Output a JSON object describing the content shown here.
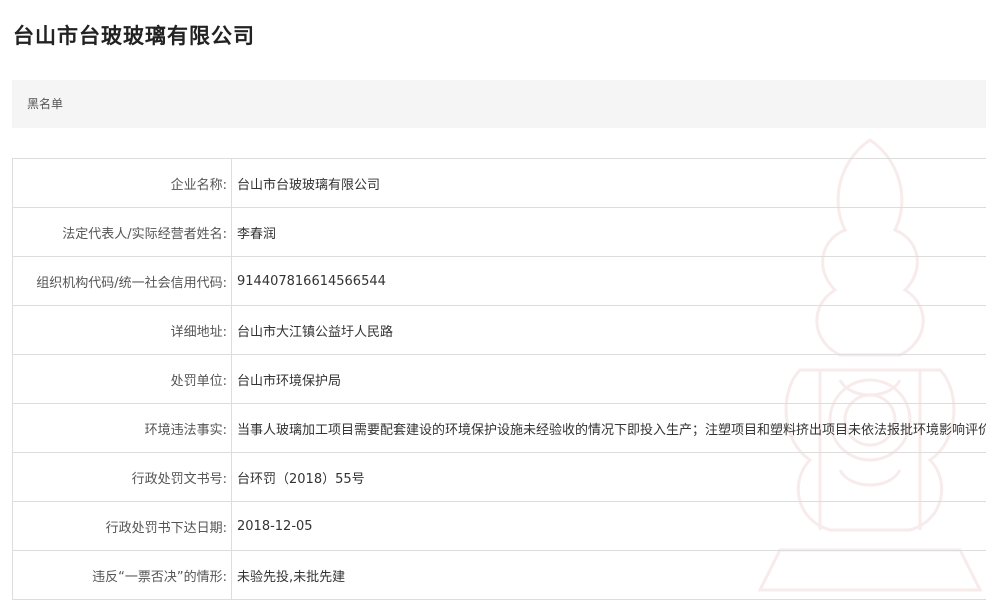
{
  "company_name_title": "台山市台玻玻璃有限公司",
  "category": "黑名单",
  "rows": [
    {
      "label": "企业名称:",
      "value": "台山市台玻玻璃有限公司"
    },
    {
      "label": "法定代表人/实际经营者姓名:",
      "value": "李春润"
    },
    {
      "label": "组织机构代码/统一社会信用代码:",
      "value": "914407816614566544"
    },
    {
      "label": "详细地址:",
      "value": "台山市大江镇公益圩人民路"
    },
    {
      "label": "处罚单位:",
      "value": "台山市环境保护局"
    },
    {
      "label": "环境违法事实:",
      "value": "当事人玻璃加工项目需要配套建设的环境保护设施未经验收的情况下即投入生产；注塑项目和塑料挤出项目未依法报批环境影响评价文件"
    },
    {
      "label": "行政处罚文书号:",
      "value": "台环罚（2018）55号"
    },
    {
      "label": "行政处罚书下达日期:",
      "value": "2018-12-05"
    },
    {
      "label": "违反“一票否决”的情形:",
      "value": "未验先投,未批先建"
    }
  ],
  "colors": {
    "category_bg": "#f5f5f5",
    "border": "#dddddd",
    "watermark": "#b03030"
  },
  "icons": {
    "watermark": "emblem-watermark-icon"
  }
}
